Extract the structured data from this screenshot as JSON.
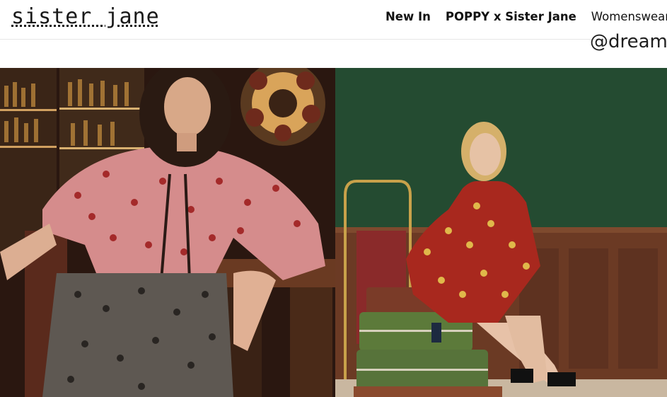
{
  "brand": {
    "logo_text": "sister jane"
  },
  "nav": {
    "items": [
      {
        "label": "New In",
        "bold": true
      },
      {
        "label": "POPPY x Sister Jane",
        "bold": true
      },
      {
        "label": "Womenswear",
        "bold": false
      }
    ]
  },
  "handle_text": "@dream",
  "colors": {
    "header_bg": "#ffffff",
    "text": "#111111",
    "left_panel_bg": "#2b1a12",
    "right_wall_green": "#1f4a2f",
    "wood_panel": "#6b3a24"
  },
  "images": [
    {
      "name": "hero-image-left",
      "icon": "photo"
    },
    {
      "name": "hero-image-right",
      "icon": "photo"
    }
  ]
}
